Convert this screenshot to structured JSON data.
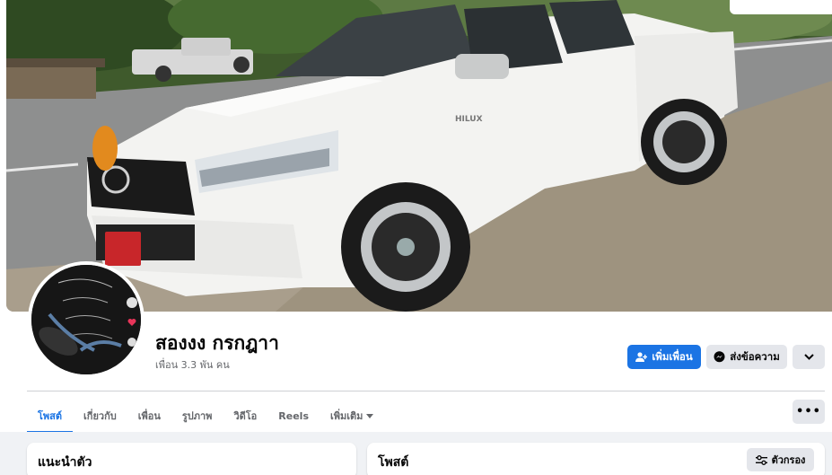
{
  "profile": {
    "name": "สองงง กรกฎาา",
    "friends": "เพื่อน 3.3 พัน คน"
  },
  "actions": {
    "add_friend": "เพิ่มเพื่อน",
    "message": "ส่งข้อความ",
    "add_friend_icon": "person-add-icon",
    "message_icon": "messenger-icon",
    "more_icon": "chevron-down-icon",
    "dots_icon": "more-dots-icon"
  },
  "tabs": [
    {
      "label": "โพสต์",
      "active": true
    },
    {
      "label": "เกี่ยวกับ"
    },
    {
      "label": "เพื่อน"
    },
    {
      "label": "รูปภาพ"
    },
    {
      "label": "วิดีโอ"
    },
    {
      "label": "Reels"
    },
    {
      "label": "เพิ่มเติม"
    }
  ],
  "intro": {
    "title": "แนะนำตัว"
  },
  "posts": {
    "title": "โพสต์",
    "filter": "ตัวกรอง",
    "filter_icon": "sliders-icon"
  },
  "colors": {
    "accent": "#1b74e4",
    "secondary_button": "#e4e6eb",
    "feed_bg": "#f0f2f5"
  }
}
